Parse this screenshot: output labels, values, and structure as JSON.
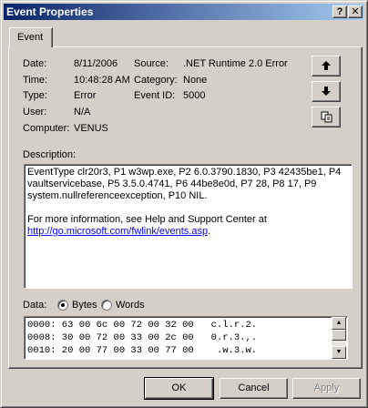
{
  "window": {
    "title": "Event Properties",
    "help_glyph": "?",
    "close_glyph": "✕"
  },
  "tabs": [
    {
      "label": "Event"
    }
  ],
  "event": {
    "date_label": "Date:",
    "date": "8/11/2006",
    "time_label": "Time:",
    "time": "10:48:28 AM",
    "type_label": "Type:",
    "type": "Error",
    "user_label": "User:",
    "user": "N/A",
    "computer_label": "Computer:",
    "computer": "VENUS",
    "source_label": "Source:",
    "source": ".NET Runtime 2.0 Error",
    "category_label": "Category:",
    "category": "None",
    "event_id_label": "Event ID:",
    "event_id": "5000"
  },
  "side_buttons": {
    "up": "arrow-up-icon",
    "down": "arrow-down-icon",
    "copy": "copy-icon"
  },
  "description": {
    "label": "Description:",
    "line1": "EventType clr20r3, P1 w3wp.exe, P2 6.0.3790.1830, P3 42435be1, P4 vaultservicebase, P5 3.5.0.4741, P6 44be8e0d, P7 28, P8 17, P9 system.nullreferenceexception, P10 NIL.",
    "line2": "For more information, see Help and Support Center at",
    "link": "http://go.microsoft.com/fwlink/events.asp",
    "link_suffix": "."
  },
  "data_section": {
    "label": "Data:",
    "bytes_label": "Bytes",
    "words_label": "Words",
    "selected": "Bytes",
    "rows": [
      "0000: 63 00 6c 00 72 00 32 00   c.l.r.2.",
      "0008: 30 00 72 00 33 00 2c 00   0.r.3.,.",
      "0010: 20 00 77 00 33 00 77 00    .w.3.w."
    ]
  },
  "buttons": {
    "ok": "OK",
    "cancel": "Cancel",
    "apply": "Apply"
  }
}
